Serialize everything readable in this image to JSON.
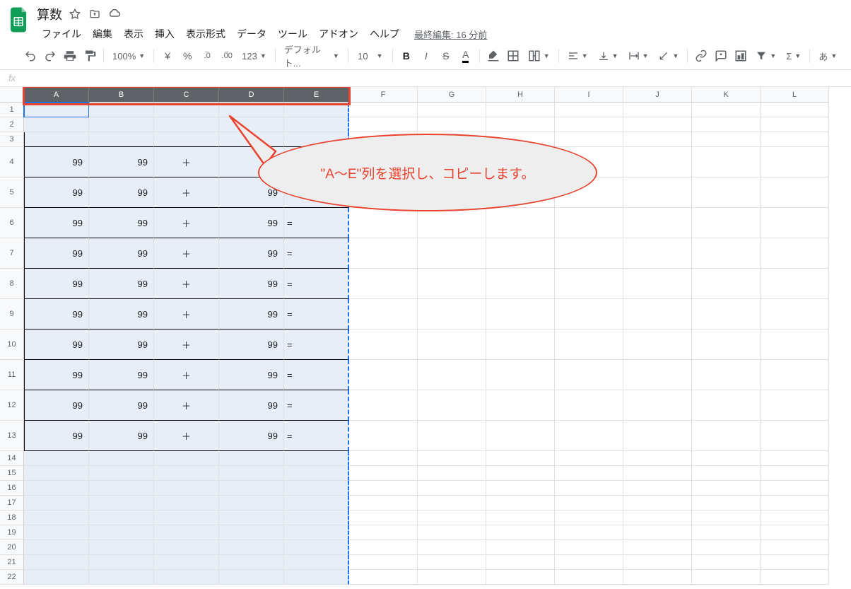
{
  "doc": {
    "title": "算数"
  },
  "menus": [
    "ファイル",
    "編集",
    "表示",
    "挿入",
    "表示形式",
    "データ",
    "ツール",
    "アドオン",
    "ヘルプ"
  ],
  "last_edit": "最終編集: 16 分前",
  "toolbar": {
    "zoom": "100%",
    "currency": "¥",
    "percent": "%",
    "dec_dec": ".0",
    "inc_dec": ".00",
    "more_fmt": "123",
    "font": "デフォルト...",
    "font_size": "10",
    "bold": "B",
    "italic": "I",
    "strike": "S",
    "text_color": "A",
    "sigma": "Σ",
    "lang": "あ"
  },
  "columns": [
    "A",
    "B",
    "C",
    "D",
    "E",
    "F",
    "G",
    "H",
    "I",
    "J",
    "K",
    "L"
  ],
  "selected_cols": [
    "A",
    "B",
    "C",
    "D",
    "E"
  ],
  "row_count": 22,
  "data_rows_start": 4,
  "data_rows_end": 13,
  "data_template": {
    "a": "99",
    "b": "99",
    "c": "＋",
    "d": "99",
    "e": "="
  },
  "callout": {
    "text": "\"A〜E\"列を選択し、コピーします。"
  }
}
